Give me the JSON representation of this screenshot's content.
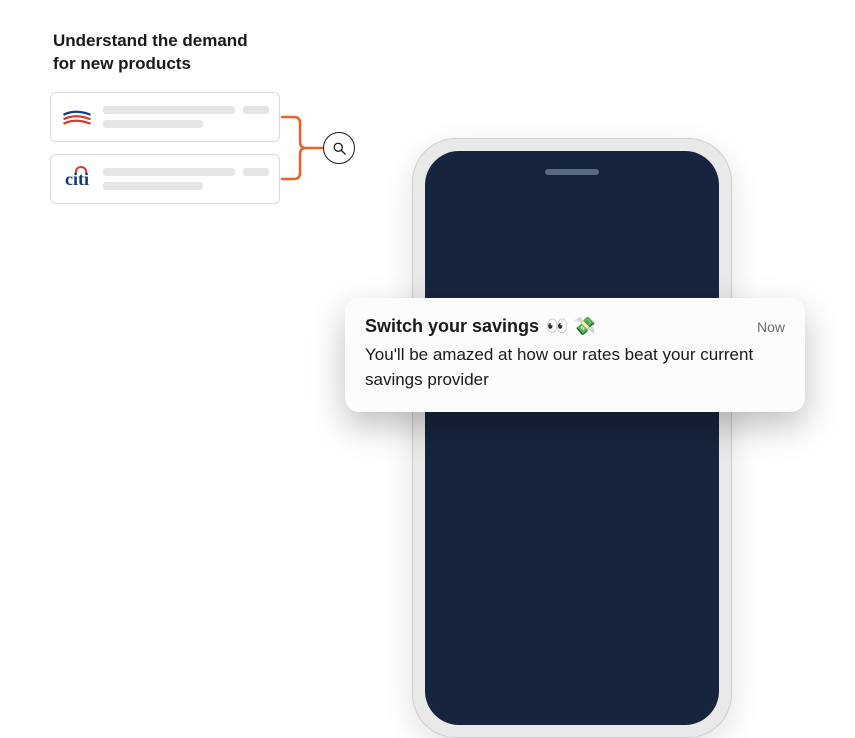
{
  "heading": {
    "line1": "Understand the demand",
    "line2": "for new products"
  },
  "bank_cards": [
    {
      "logo": "bank-of-america"
    },
    {
      "logo": "citi"
    }
  ],
  "search_icon": "magnifying-glass",
  "phone": {
    "screen_color": "#16243d"
  },
  "notification": {
    "title": "Switch your savings",
    "title_emojis": "👀 💸",
    "time": "Now",
    "body": "You'll be amazed at how our rates beat your current savings provider"
  }
}
